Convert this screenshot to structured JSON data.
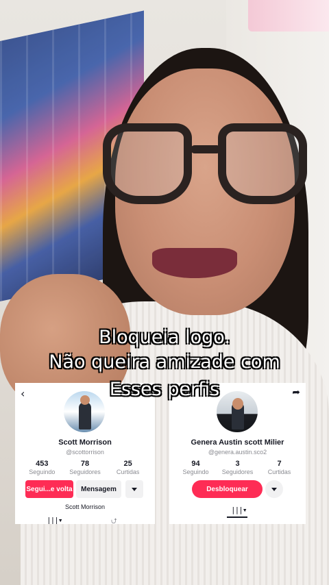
{
  "caption": {
    "line1": "Bloqueia logo.",
    "line2": "Não queira amizade com",
    "line3": "Esses perfis"
  },
  "profile_left": {
    "name": "Scott Morrison",
    "handle": "@scottorrison",
    "following_count": "453",
    "following_label": "Seguindo",
    "followers_count": "78",
    "followers_label": "Seguidores",
    "likes_count": "25",
    "likes_label": "Curtidas",
    "follow_back_label": "Segui...e volta",
    "message_label": "Mensagem",
    "suggested_name": "Scott Morrison"
  },
  "profile_right": {
    "name": "Genera Austin scott Milier",
    "handle": "@genera.austin.sco2",
    "following_count": "94",
    "following_label": "Seguindo",
    "followers_count": "3",
    "followers_label": "Seguidores",
    "likes_count": "7",
    "likes_label": "Curtidas",
    "unblock_label": "Desbloquear"
  },
  "icons": {
    "back": "back-arrow-icon",
    "share": "share-icon",
    "grid": "grid-icon",
    "more": "chevron-down-icon",
    "repost": "repost-icon"
  },
  "colors": {
    "accent": "#fe2c55",
    "text": "#161823",
    "muted": "#8a8b91",
    "button_grey": "#f1f1f2"
  }
}
